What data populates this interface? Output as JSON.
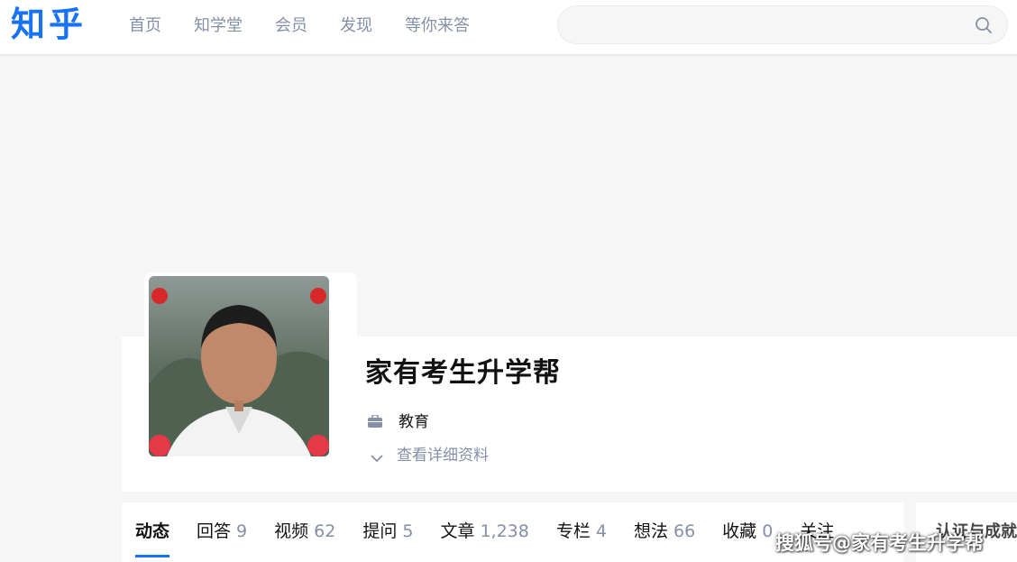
{
  "header": {
    "logo": "知乎",
    "nav": [
      "首页",
      "知学堂",
      "会员",
      "发现",
      "等你来答"
    ],
    "search": {
      "value": "",
      "placeholder": ""
    }
  },
  "profile": {
    "name": "家有考生升学帮",
    "industry": "教育",
    "details_label": "查看详细资料"
  },
  "tabs": [
    {
      "label": "动态",
      "count": ""
    },
    {
      "label": "回答",
      "count": "9"
    },
    {
      "label": "视频",
      "count": "62"
    },
    {
      "label": "提问",
      "count": "5"
    },
    {
      "label": "文章",
      "count": "1,238"
    },
    {
      "label": "专栏",
      "count": "4"
    },
    {
      "label": "想法",
      "count": "66"
    },
    {
      "label": "收藏",
      "count": "0"
    },
    {
      "label": "关注",
      "count": ""
    }
  ],
  "side": {
    "title": "认证与成就"
  },
  "watermark": "搜狐号@家有考生升学帮",
  "colors": {
    "brand": "#1772f6",
    "muted": "#8590a6"
  }
}
